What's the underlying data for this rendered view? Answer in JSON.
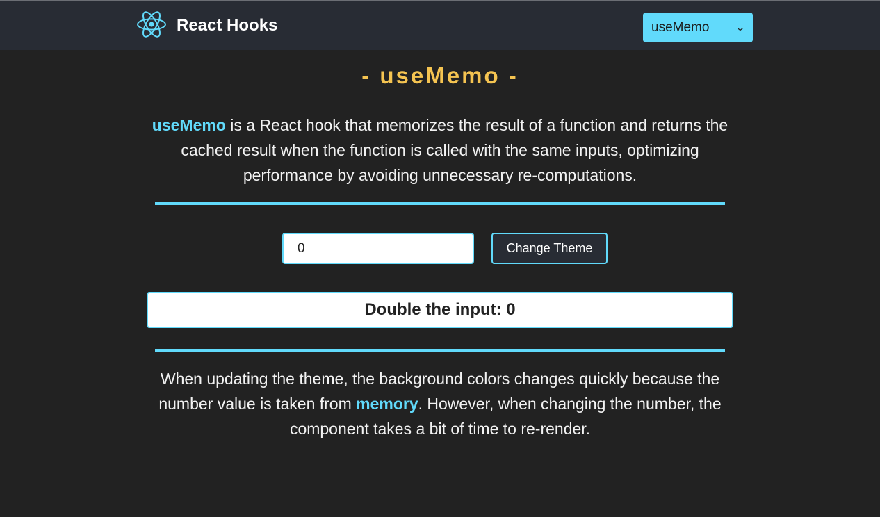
{
  "header": {
    "logo_icon": "react-atom-icon",
    "title": "React Hooks",
    "select": {
      "value": "useMemo"
    }
  },
  "main": {
    "title": "- useMemo -",
    "description": {
      "highlight": "useMemo",
      "text": " is a React hook that memorizes the result of a function and returns the cached result when the function is called with the same inputs, optimizing performance by avoiding unnecessary re-computations."
    },
    "controls": {
      "number_value": "0",
      "change_theme_label": "Change Theme"
    },
    "result": {
      "label": "Double the input: ",
      "value": "0"
    },
    "note": {
      "before": "When updating the theme, the background colors changes quickly because the number value is taken from ",
      "highlight": "memory",
      "after": ". However, when changing the number, the component takes a bit of time to re-render."
    }
  },
  "colors": {
    "accent": "#61dafb",
    "title": "#f5c451",
    "background": "#222222",
    "navbar": "#282c34"
  }
}
